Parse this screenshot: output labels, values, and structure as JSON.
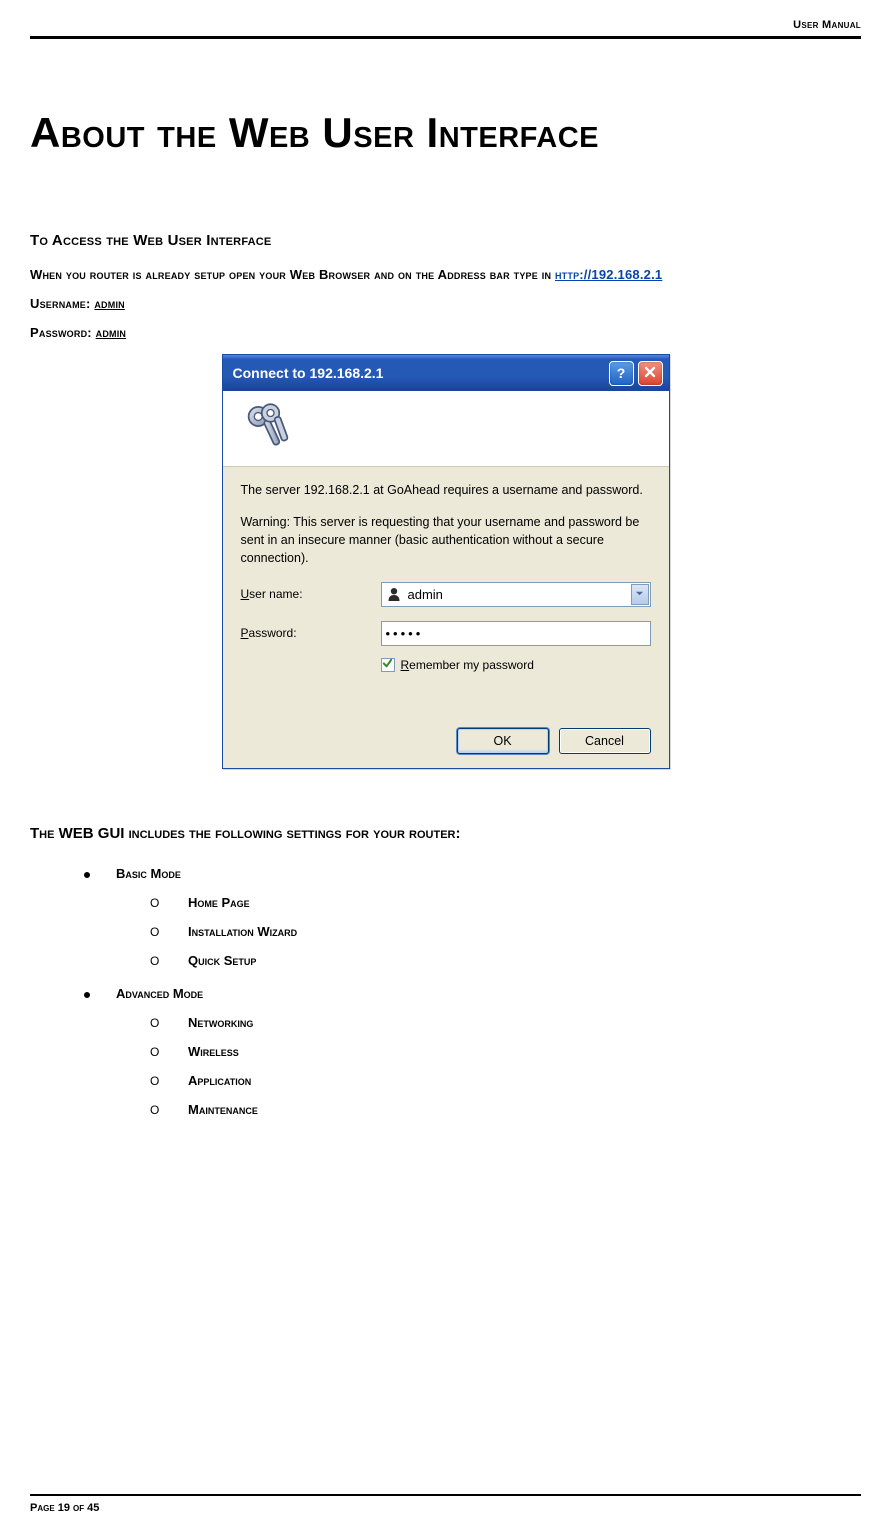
{
  "header": {
    "label": "User Manual"
  },
  "title": "About the Web User Interface",
  "section1": {
    "heading": "To Access the Web User Interface",
    "intro_prefix": "When you router is already setup open your Web Browser and on the Address bar type in ",
    "url_text": "http://192.168.2.1",
    "username_label": "Username: ",
    "username_value": "admin",
    "password_label": "Password: ",
    "password_value": "admin"
  },
  "dialog": {
    "title": "Connect to 192.168.2.1",
    "server_text": "The server 192.168.2.1 at GoAhead requires a username and password.",
    "warning_text": "Warning: This server is requesting that your username and password be sent in an insecure manner (basic authentication without a secure connection).",
    "username_label_pre": "U",
    "username_label_post": "ser name:",
    "username_value": "admin",
    "password_label_pre": "P",
    "password_label_post": "assword:",
    "password_dots": "•••••",
    "remember_pre": "R",
    "remember_post": "emember my password",
    "ok_label": "OK",
    "cancel_label": "Cancel"
  },
  "section2": {
    "heading": "The WEB GUI includes the following settings for your router:",
    "modes": [
      {
        "label": "Basic Mode",
        "items": [
          "Home Page",
          "Installation Wizard",
          "Quick Setup"
        ]
      },
      {
        "label": "Advanced Mode",
        "items": [
          "Networking",
          "Wireless",
          "Application",
          "Maintenance"
        ]
      }
    ]
  },
  "footer": {
    "page": "Page 19 of 45"
  }
}
